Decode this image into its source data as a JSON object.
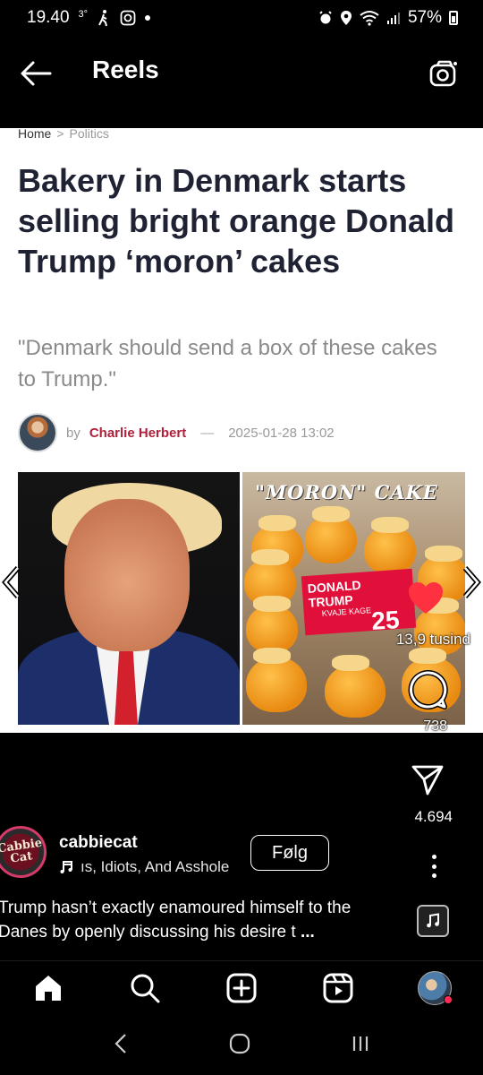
{
  "status_bar": {
    "time": "19.40",
    "temp": "3°",
    "battery": "57%"
  },
  "header": {
    "title": "Reels"
  },
  "article": {
    "breadcrumb_home": "Home",
    "breadcrumb_sep": ">",
    "breadcrumb_current": "Politics",
    "headline": "Bakery in Denmark starts selling bright orange Donald Trump ‘moron’ cakes",
    "subheadline": "\"Denmark should send a box of these cakes to Trump.\"",
    "by": "by",
    "author": "Charlie Herbert",
    "dash": "—",
    "date": "2025-01-28 13:02",
    "cake_label": "\"MORON\" CAKE",
    "tag_name": "DONALD TRUMP",
    "tag_kind": "KVAJE KAGE",
    "tag_price": "25"
  },
  "actions": {
    "likes": "13,9 tusind",
    "comments": "738",
    "shares": "4.694"
  },
  "post": {
    "avatar_text_1": "Cabbie",
    "avatar_text_2": "Cat",
    "username": "cabbiecat",
    "audio": "ıs, Idiots, And Asshole",
    "follow": "Følg",
    "caption": "Trump hasn’t exactly enamoured himself to the Danes by openly discussing his desire t",
    "caption_more": "..."
  },
  "colors": {
    "like_red": "#ff3040",
    "author_red": "#b0203a",
    "headline": "#1f2233"
  },
  "icons": {
    "back": "arrow-left-icon",
    "camera": "camera-icon",
    "like": "heart-icon",
    "comment": "comment-icon",
    "share": "send-icon",
    "more": "more-vertical-icon",
    "home": "home-icon",
    "search": "search-icon",
    "create": "plus-square-icon",
    "reels": "reels-icon"
  }
}
